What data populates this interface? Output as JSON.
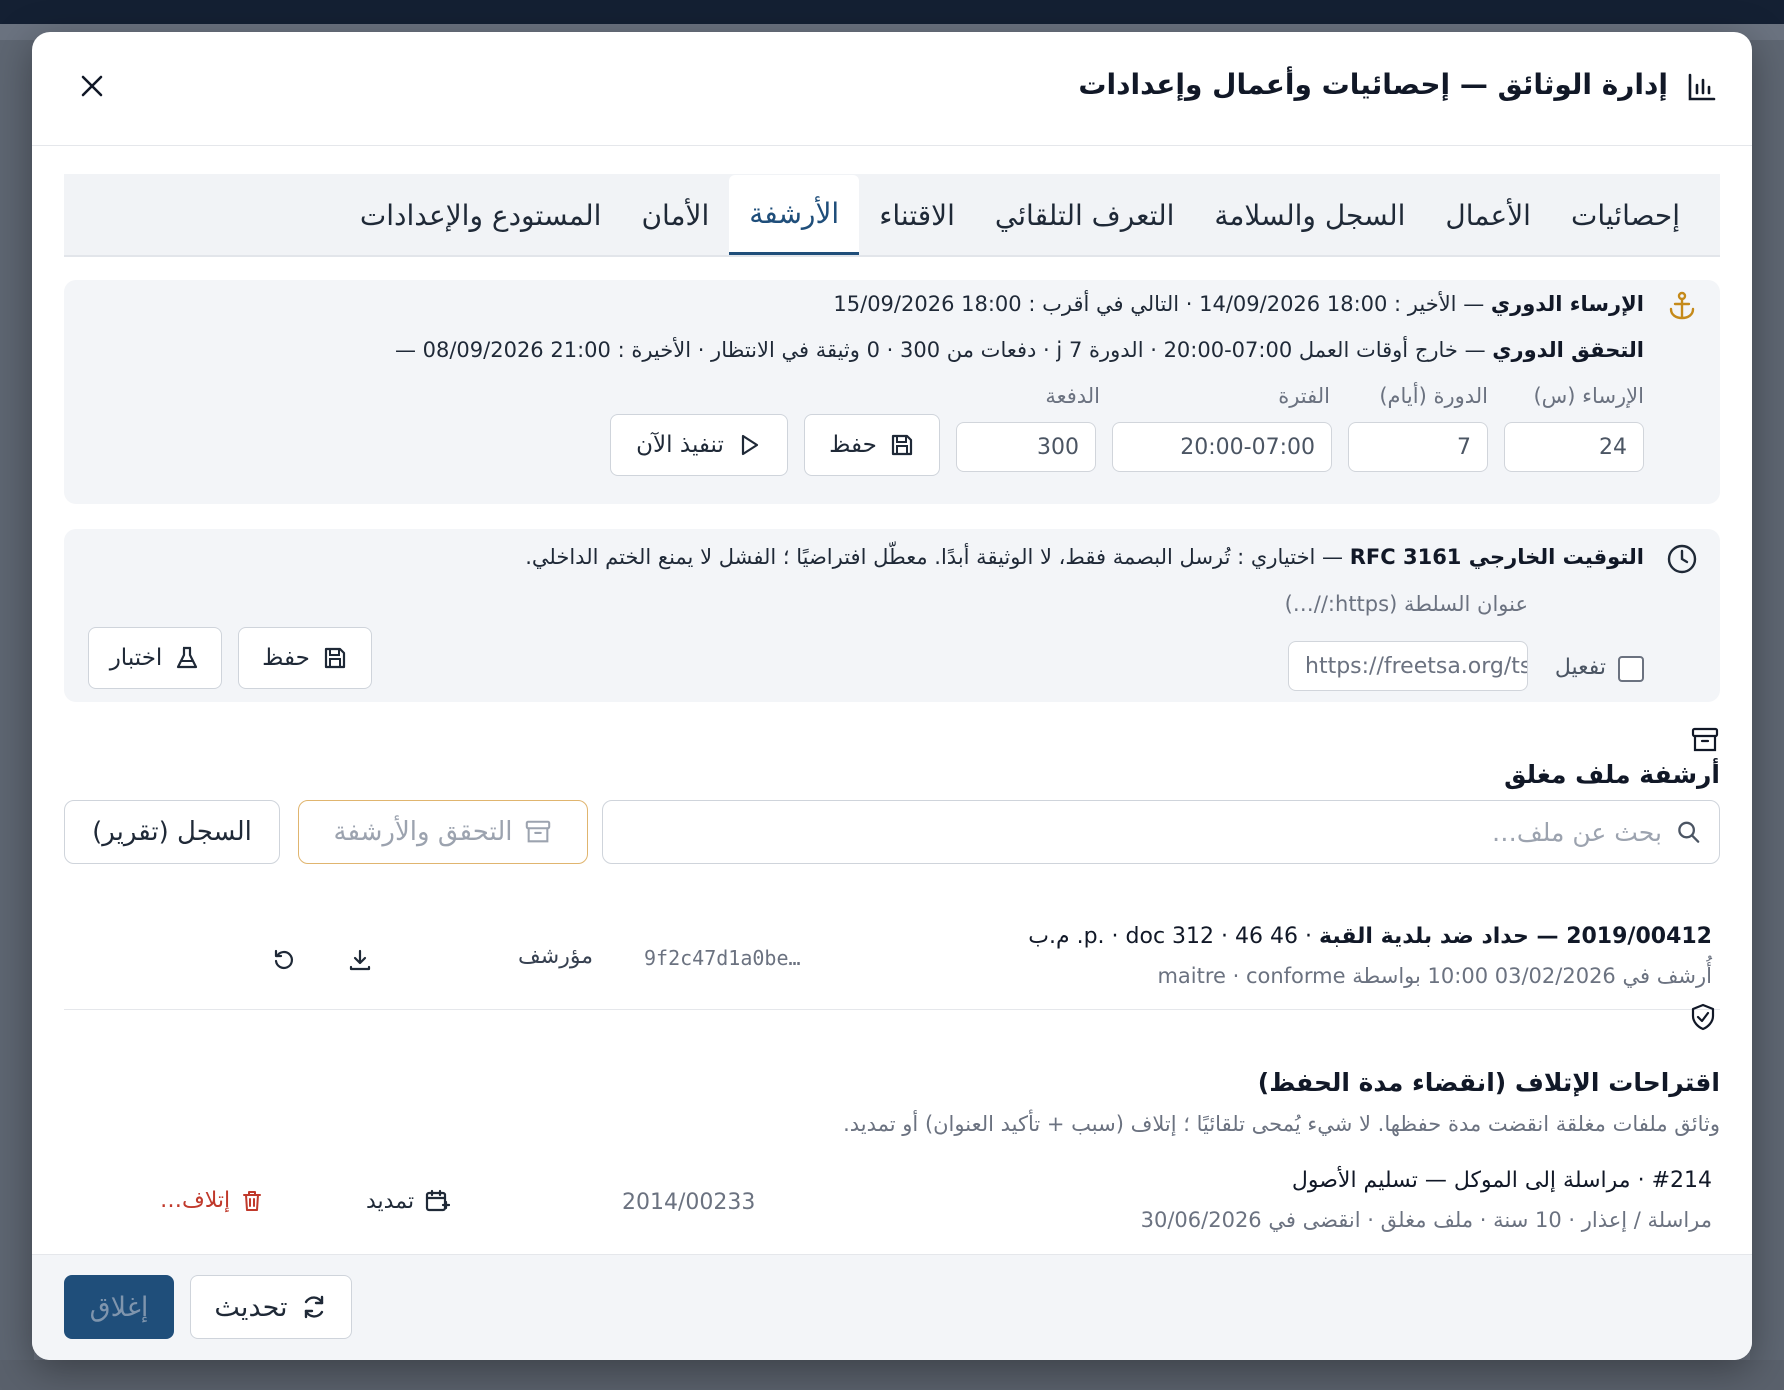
{
  "modal": {
    "title": "إدارة الوثائق — إحصائيات وأعمال وإعدادات"
  },
  "tabs": [
    {
      "label": "إحصائيات"
    },
    {
      "label": "الأعمال"
    },
    {
      "label": "السجل والسلامة"
    },
    {
      "label": "التعرف التلقائي"
    },
    {
      "label": "الاقتناء"
    },
    {
      "label": "الأرشفة"
    },
    {
      "label": "الأمان"
    },
    {
      "label": "المستودع والإعدادات"
    }
  ],
  "active_tab": "الأرشفة",
  "anchoring": {
    "title": "الإرساء الدوري",
    "text": " — الأخير : 18:00 14/09/2026 · التالي في أقرب : 18:00 15/09/2026",
    "verify_title": "التحقق الدوري",
    "verify_text": " — خارج أوقات العمل 07:00-20:00 · الدورة 7 j · دفعات من 300 · 0 وثيقة في الانتظار · الأخيرة : 21:00 08/09/2026 —",
    "fields": {
      "anchor_label": "الإرساء (س)",
      "anchor_value": "24",
      "cycle_label": "الدورة (أيام)",
      "cycle_value": "7",
      "window_label": "الفترة",
      "window_value": "20:00-07:00",
      "batch_label": "الدفعة",
      "batch_value": "300"
    },
    "save_label": "حفظ",
    "run_label": "تنفيذ الآن"
  },
  "timestamp": {
    "title": "التوقيت الخارجي RFC 3161",
    "text": " — اختياري : تُرسل البصمة فقط، لا الوثيقة أبدًا. معطّل افتراضيًا ؛ الفشل لا يمنع الختم الداخلي.",
    "authority_label": "عنوان السلطة (https://…)",
    "authority_value": "https://freetsa.org/tsr",
    "enable_label": "تفعيل",
    "save_label": "حفظ",
    "test_label": "اختبار"
  },
  "archive": {
    "title": "أرشفة ملف مغلق",
    "search_placeholder": "بحث عن ملف…",
    "verify_archive_label": "التحقق والأرشفة",
    "log_label": "السجل (تقرير)",
    "item": {
      "title": "2019/00412 — حداد ضد بلدية القبة",
      "meta": " · 46 46 · 312 p. · doc. م.ب",
      "sub": "أُرشف في 03/02/2026 10:00 بواسطة maitre · conforme",
      "hash": "9f2c47d1a0be…",
      "status": "مؤرشف"
    }
  },
  "destruction": {
    "title": "اقتراحات الإتلاف (انقضاء مدة الحفظ)",
    "desc": "وثائق ملفات مغلقة انقضت مدة حفظها. لا شيء يُمحى تلقائيًا ؛ إتلاف (سبب + تأكيد العنوان) أو تمديد.",
    "item": {
      "title": "#214 · مراسلة إلى الموكل — تسليم الأصول",
      "sub": "مراسلة / إعذار · 10 سنة · ملف مغلق · انقضى في 30/06/2026",
      "ref": "2014/00233",
      "extend_label": "تمديد",
      "destroy_label": "إتلاف…"
    }
  },
  "footer": {
    "refresh_label": "تحديث",
    "close_label": "إغلاق"
  },
  "colors": {
    "accent": "#1f4e7a",
    "anchor_icon": "#c58a1a",
    "danger": "#c0392b",
    "archive_border": "#e0b56f"
  }
}
